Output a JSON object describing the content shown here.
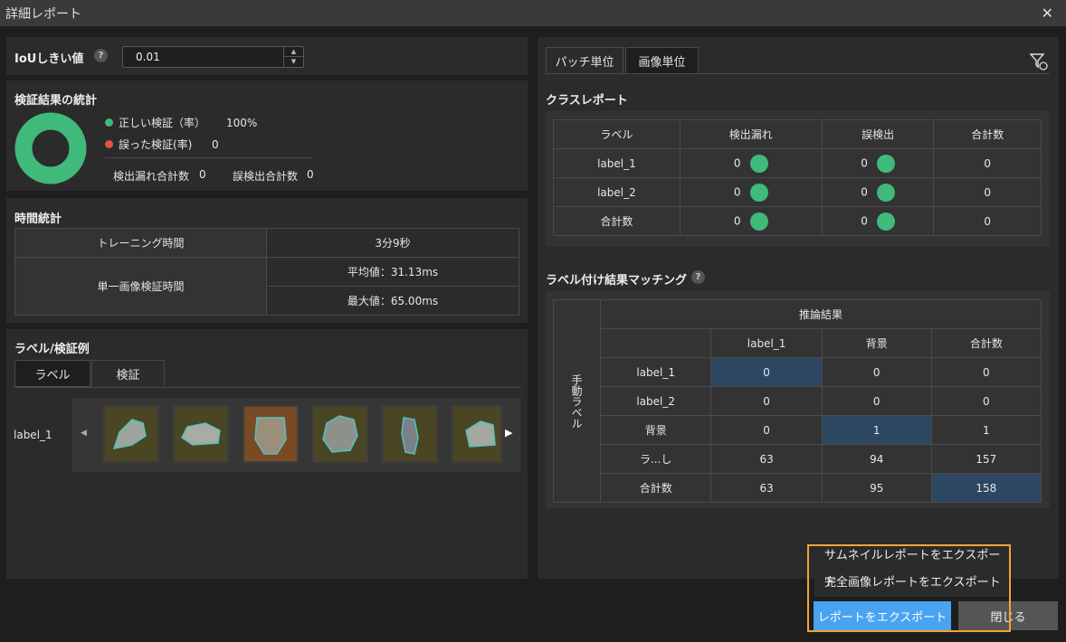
{
  "window": {
    "title": "詳細レポート",
    "close_icon": "close-icon"
  },
  "iou": {
    "label": "IoUしきい値",
    "help": "?",
    "value": "0.01",
    "up": "▲",
    "down": "▼"
  },
  "stats": {
    "title": "検証結果の統計",
    "correct_label": "正しい検証（率）",
    "correct_value": "100%",
    "wrong_label": "誤った検証(率)",
    "wrong_value": "0",
    "missed_label": "検出漏れ合計数",
    "missed_value": "0",
    "false_label": "誤検出合計数",
    "false_value": "0",
    "colors": {
      "correct": "#3fba7b",
      "wrong": "#e2543d"
    }
  },
  "time": {
    "title": "時間統計",
    "training_label": "トレーニング時間",
    "training_value": "3分9秒",
    "single_label": "単一画像検証時間",
    "avg": "平均値：31.13ms",
    "max": "最大値：65.00ms"
  },
  "examples": {
    "title": "ラベル/検証例",
    "tabs": [
      "ラベル",
      "検証"
    ],
    "row_label": "label_1",
    "prev": "◀",
    "next": "▶"
  },
  "right_tabs": [
    "パッチ単位",
    "画像単位"
  ],
  "class_report": {
    "title": "クラスレポート",
    "headers": [
      "ラベル",
      "検出漏れ",
      "誤検出",
      "合計数"
    ],
    "rows": [
      {
        "label": "label_1",
        "missed": "0",
        "false": "0",
        "total": "0"
      },
      {
        "label": "label_2",
        "missed": "0",
        "false": "0",
        "total": "0"
      },
      {
        "label": "合計数",
        "missed": "0",
        "false": "0",
        "total": "0"
      }
    ]
  },
  "matching": {
    "title": "ラベル付け結果マッチング",
    "help": "?",
    "col_group": "推論結果",
    "row_group": "手動ラベル",
    "cols": [
      "label_1",
      "背景",
      "合計数"
    ],
    "rows": [
      {
        "label": "label_1",
        "values": [
          "0",
          "0",
          "0"
        ]
      },
      {
        "label": "label_2",
        "values": [
          "0",
          "0",
          "0"
        ]
      },
      {
        "label": "背景",
        "values": [
          "0",
          "1",
          "1"
        ]
      },
      {
        "label": "ラ...し",
        "values": [
          "63",
          "94",
          "157"
        ]
      },
      {
        "label": "合計数",
        "values": [
          "63",
          "95",
          "158"
        ]
      }
    ]
  },
  "export_menu": {
    "thumbnail": "サムネイルレポートをエクスポート",
    "full": "完全画像レポートをエクスポート"
  },
  "buttons": {
    "export": "レポートをエクスポート",
    "close": "閉じる"
  }
}
